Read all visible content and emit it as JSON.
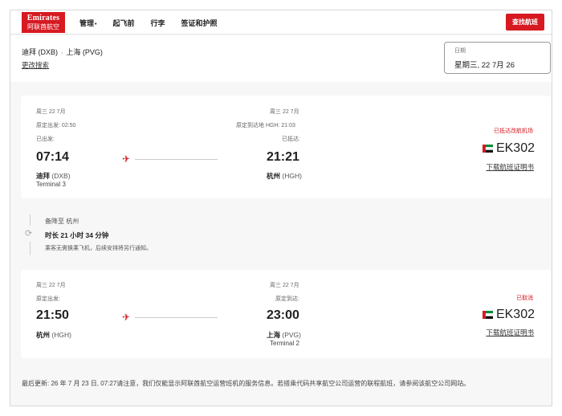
{
  "header": {
    "logo_en": "Emirates",
    "logo_cn": "阿联酋航空",
    "nav": [
      {
        "label": "管理",
        "suffix": "•"
      },
      {
        "label": "起飞前",
        "suffix": ""
      },
      {
        "label": "行李",
        "suffix": ""
      },
      {
        "label": "签证和护照",
        "suffix": ""
      }
    ],
    "find_button": "查找航班"
  },
  "summary": {
    "origin": "迪拜 (DXB)",
    "arrow": "›",
    "destination": "上海 (PVG)",
    "modify_search": "更改搜索",
    "date_label": "日期",
    "date_value": "星期三, 22 7月 26"
  },
  "segment1": {
    "dep_date": "周三 22 7月",
    "dep_scheduled": "原定出发: 02:50",
    "dep_status": "已出发:",
    "dep_time": "07:14",
    "dep_city": "迪拜",
    "dep_code": "(DXB)",
    "dep_terminal": "Terminal 3",
    "arr_date": "周三 22 7月",
    "arr_scheduled": "原定到达地 HGH: 21:03",
    "arr_status": "已抵达:",
    "arr_time": "21:21",
    "arr_city": "杭州",
    "arr_code": "(HGH)",
    "status": "已抵达改航机场",
    "flight_no": "EK302",
    "download": "下载航班证明书",
    "colors": {
      "accent": "#d71921"
    }
  },
  "diversion": {
    "line1": "备降至 杭州",
    "line2": "时长 21 小时 34 分钟",
    "line3": "乘客无需换乘飞机，后续安排将另行通知。"
  },
  "segment2": {
    "dep_date": "周三 22 7月",
    "dep_scheduled": "原定出发:",
    "dep_time": "21:50",
    "dep_city": "杭州",
    "dep_code": "(HGH)",
    "arr_date": "周三 22 7月",
    "arr_scheduled": "原定到达:",
    "arr_time": "23:00",
    "arr_city": "上海",
    "arr_code": "(PVG)",
    "arr_terminal": "Terminal 2",
    "status": "已取消",
    "flight_no": "EK302",
    "download": "下载航班证明书"
  },
  "footer": {
    "last_updated": "最后更新: 26 年 7 月 23 日, 07:27",
    "notice": "请注意，我们仅能显示阿联酋航空运营班机的服务信息。若搭乘代码共享航空公司运营的联程航班，请参阅该航空公司网站。"
  }
}
